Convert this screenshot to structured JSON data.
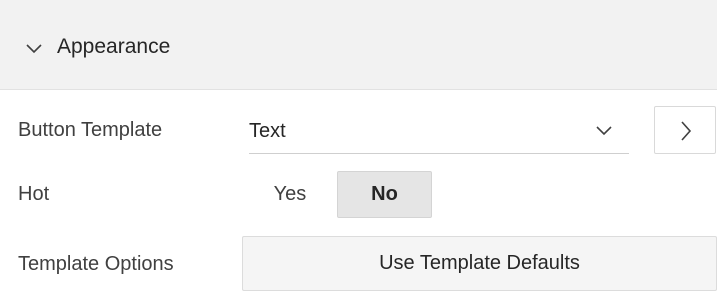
{
  "section": {
    "title": "Appearance",
    "expanded": true,
    "toggle_icon": "chevron-down-icon"
  },
  "fields": {
    "button_template": {
      "label": "Button Template",
      "value": "Text",
      "dropdown_icon": "chevron-down-icon",
      "navigate_icon": "chevron-right-icon"
    },
    "hot": {
      "label": "Hot",
      "options": [
        "Yes",
        "No"
      ],
      "selected": "No"
    },
    "template_options": {
      "label": "Template Options",
      "button_label": "Use Template Defaults"
    }
  },
  "colors": {
    "header_bg": "#f2f2f2",
    "selected_toggle_bg": "#e5e5e5",
    "button_bg": "#f5f5f5",
    "text": "#262626"
  }
}
